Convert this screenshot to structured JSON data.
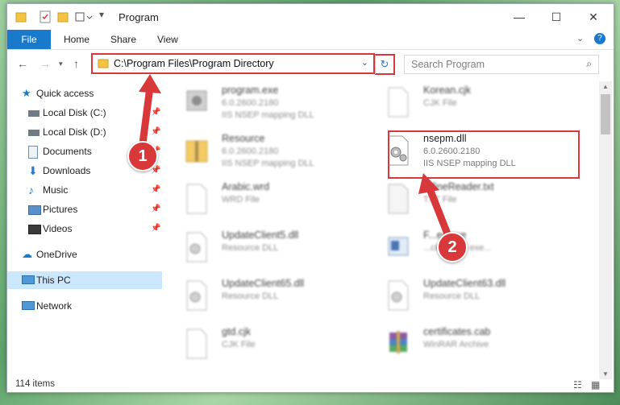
{
  "window": {
    "title": "Program"
  },
  "ribbon": {
    "tabs": [
      "File",
      "Home",
      "Share",
      "View"
    ]
  },
  "address": {
    "path": "C:\\Program Files\\Program Directory"
  },
  "search": {
    "placeholder": "Search Program"
  },
  "sidebar": {
    "items": [
      {
        "label": "Quick access",
        "icon": "star-icon",
        "pinned": false
      },
      {
        "label": "Local Disk (C:)",
        "icon": "drive-icon",
        "pinned": true
      },
      {
        "label": "Local Disk (D:)",
        "icon": "drive-icon",
        "pinned": true
      },
      {
        "label": "Documents",
        "icon": "documents-icon",
        "pinned": true
      },
      {
        "label": "Downloads",
        "icon": "download-icon",
        "pinned": true
      },
      {
        "label": "Music",
        "icon": "music-icon",
        "pinned": true
      },
      {
        "label": "Pictures",
        "icon": "pictures-icon",
        "pinned": true
      },
      {
        "label": "Videos",
        "icon": "videos-icon",
        "pinned": true
      },
      {
        "label": "OneDrive",
        "icon": "cloud-icon",
        "pinned": false
      },
      {
        "label": "This PC",
        "icon": "computer-icon",
        "pinned": false
      },
      {
        "label": "Network",
        "icon": "network-icon",
        "pinned": false
      }
    ]
  },
  "files": [
    {
      "name": "program.exe",
      "sub1": "6.0.2600.2180",
      "sub2": "IIS NSEP mapping DLL",
      "icon": "exe-icon"
    },
    {
      "name": "Korean.cjk",
      "sub1": "CJK File",
      "sub2": "",
      "icon": "file-icon"
    },
    {
      "name": "Resource",
      "sub1": "6.0.2600.2180",
      "sub2": "IIS NSEP mapping DLL",
      "icon": "zip-folder-icon"
    },
    {
      "name": "nsepm.dll",
      "sub1": "6.0.2600.2180",
      "sub2": "IIS NSEP mapping DLL",
      "icon": "dll-gear-icon"
    },
    {
      "name": "Arabic.wrd",
      "sub1": "WRD File",
      "sub2": "",
      "icon": "file-icon"
    },
    {
      "name": "...fineReader.txt",
      "sub1": "TXT File",
      "sub2": "",
      "icon": "file-icon"
    },
    {
      "name": "UpdateClient5.dll",
      "sub1": "Resource DLL",
      "sub2": "",
      "icon": "dll-gear-icon"
    },
    {
      "name": "F...ec.exe",
      "sub1": "...ckground exe...",
      "sub2": "",
      "icon": "exe-icon"
    },
    {
      "name": "UpdateClient65.dll",
      "sub1": "Resource DLL",
      "sub2": "",
      "icon": "dll-gear-icon"
    },
    {
      "name": "UpdateClient63.dll",
      "sub1": "Resource DLL",
      "sub2": "",
      "icon": "dll-gear-icon"
    },
    {
      "name": "gtd.cjk",
      "sub1": "CJK File",
      "sub2": "",
      "icon": "file-icon"
    },
    {
      "name": "certificates.cab",
      "sub1": "WinRAR Archive",
      "sub2": "",
      "icon": "winrar-icon"
    }
  ],
  "status": {
    "count": "114 items"
  },
  "annotations": {
    "step1": "1",
    "step2": "2",
    "color": "#d9383a"
  }
}
